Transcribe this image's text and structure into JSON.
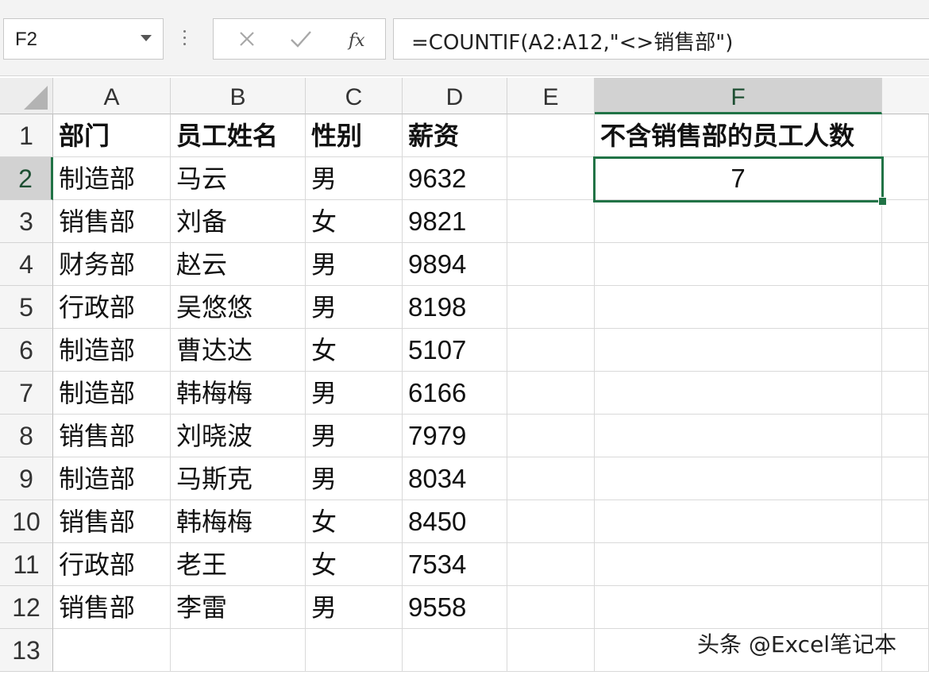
{
  "name_box": {
    "value": "F2"
  },
  "formula_bar": {
    "formula": "=COUNTIF(A2:A12,\"<>销售部\")",
    "fx_label": "fx"
  },
  "columns": [
    "A",
    "B",
    "C",
    "D",
    "E",
    "F"
  ],
  "rows": [
    "1",
    "2",
    "3",
    "4",
    "5",
    "6",
    "7",
    "8",
    "9",
    "10",
    "11",
    "12",
    "13"
  ],
  "headers": {
    "a": "部门",
    "b": "员工姓名",
    "c": "性别",
    "d": "薪资",
    "f": "不含销售部的员工人数"
  },
  "data": [
    {
      "a": "制造部",
      "b": "马云",
      "c": "男",
      "d": "9632"
    },
    {
      "a": "销售部",
      "b": "刘备",
      "c": "女",
      "d": "9821"
    },
    {
      "a": "财务部",
      "b": "赵云",
      "c": "男",
      "d": "9894"
    },
    {
      "a": "行政部",
      "b": "吴悠悠",
      "c": "男",
      "d": "8198"
    },
    {
      "a": "制造部",
      "b": "曹达达",
      "c": "女",
      "d": "5107"
    },
    {
      "a": "制造部",
      "b": "韩梅梅",
      "c": "男",
      "d": "6166"
    },
    {
      "a": "销售部",
      "b": "刘晓波",
      "c": "男",
      "d": "7979"
    },
    {
      "a": "制造部",
      "b": "马斯克",
      "c": "男",
      "d": "8034"
    },
    {
      "a": "销售部",
      "b": "韩梅梅",
      "c": "女",
      "d": "8450"
    },
    {
      "a": "行政部",
      "b": "老王",
      "c": "女",
      "d": "7534"
    },
    {
      "a": "销售部",
      "b": "李雷",
      "c": "男",
      "d": "9558"
    }
  ],
  "result": {
    "f2": "7"
  },
  "watermark": "头条 @Excel笔记本",
  "colors": {
    "accent": "#217346"
  }
}
